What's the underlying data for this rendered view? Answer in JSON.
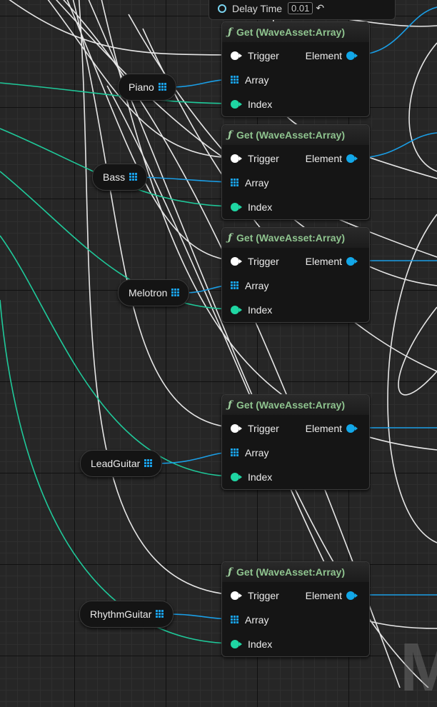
{
  "top_node": {
    "label": "Delay Time",
    "value": "0.01"
  },
  "get_nodes": [
    {
      "title": "Get (WaveAsset:Array)",
      "trigger": "Trigger",
      "array": "Array",
      "index": "Index",
      "element": "Element"
    },
    {
      "title": "Get (WaveAsset:Array)",
      "trigger": "Trigger",
      "array": "Array",
      "index": "Index",
      "element": "Element"
    },
    {
      "title": "Get (WaveAsset:Array)",
      "trigger": "Trigger",
      "array": "Array",
      "index": "Index",
      "element": "Element"
    },
    {
      "title": "Get (WaveAsset:Array)",
      "trigger": "Trigger",
      "array": "Array",
      "index": "Index",
      "element": "Element"
    },
    {
      "title": "Get (WaveAsset:Array)",
      "trigger": "Trigger",
      "array": "Array",
      "index": "Index",
      "element": "Element"
    }
  ],
  "variables": [
    "Piano",
    "Bass",
    "Melotron",
    "LeadGuitar",
    "RhythmGuitar"
  ],
  "watermark": "M",
  "colors": {
    "exec_wire": "#e6e6e6",
    "int_wire": "#1fc99a",
    "array_wire": "#1a9ee6",
    "node_title": "#8fc48f",
    "background": "#262626"
  },
  "icons": {
    "function": "f",
    "array_variable": "grid-icon",
    "reset": "undo-arrow-icon"
  }
}
